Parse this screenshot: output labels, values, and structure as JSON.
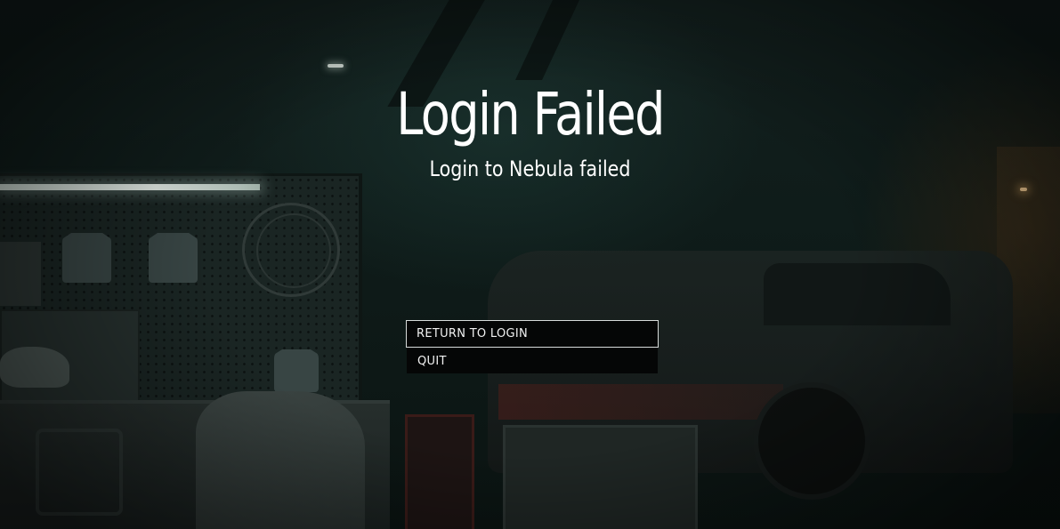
{
  "screen": {
    "title": "Login Failed",
    "subtitle": "Login to Nebula failed"
  },
  "menu": {
    "items": [
      {
        "label": "RETURN TO LOGIN",
        "selected": true
      },
      {
        "label": "QUIT",
        "selected": false
      }
    ]
  },
  "colors": {
    "text": "#ffffff",
    "button_bg": "#050606",
    "selected_border": "#d8dcdb",
    "background": "#0f1c1a"
  }
}
